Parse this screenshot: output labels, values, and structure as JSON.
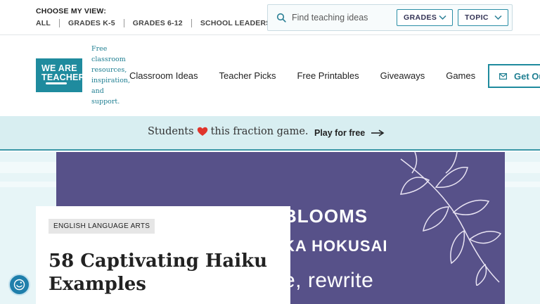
{
  "topbar": {
    "choose_view": "CHOOSE MY VIEW:",
    "view_links": [
      "ALL",
      "GRADES K-5",
      "GRADES 6-12",
      "SCHOOL LEADERS"
    ],
    "search": {
      "placeholder": "Find teaching ideas",
      "icon": "search-icon"
    },
    "grades_dropdown": "GRADES",
    "topic_dropdown": "TOPIC"
  },
  "header": {
    "logo_lines": [
      "WE ARE",
      "TEACHERS"
    ],
    "tagline": "Free classroom resources, inspiration, and support.",
    "nav": [
      "Classroom Ideas",
      "Teacher Picks",
      "Free Printables",
      "Giveaways",
      "Games"
    ],
    "cta": "Get Ou"
  },
  "promo": {
    "text_before": "Students",
    "text_after": "this fraction game.",
    "link": "Play for free",
    "heart_icon": "heart-icon",
    "arrow_icon": "arrow-right-icon"
  },
  "hero": {
    "line1": "BLOOMS",
    "line2": "KA HOKUSAI",
    "line3": "e, rewrite"
  },
  "article": {
    "category": "ENGLISH LANGUAGE ARTS",
    "title": "58 Captivating Haiku Examples"
  },
  "colors": {
    "brand_teal": "#1f8b9e",
    "promo_bg": "#d8eef1",
    "hero_purple": "#575189"
  }
}
